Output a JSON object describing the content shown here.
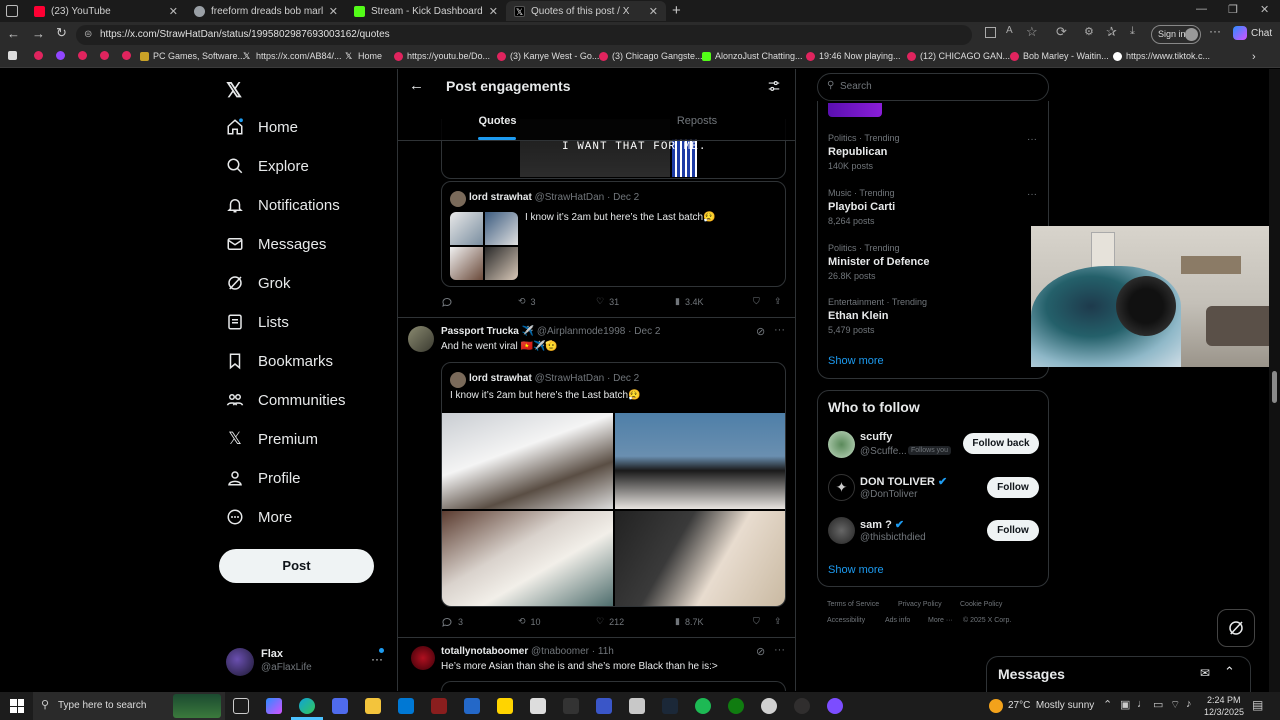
{
  "browser": {
    "tabs": [
      {
        "title": "(23) YouTube",
        "color": "#ff0033"
      },
      {
        "title": "freeform dreads bob marley - Go",
        "color": "#9aa0a6"
      },
      {
        "title": "Stream - Kick Dashboard",
        "color": "#53fc18"
      },
      {
        "title": "Quotes of this post / X",
        "color": "#ffffff"
      }
    ],
    "url": "https://x.com/StrawHatDan/status/1995802987693003162/quotes",
    "sign_in": "Sign in",
    "chat": "Chat",
    "bookmarks": [
      "PC Games, Software...",
      "https://x.com/AB84/...",
      "Home",
      "https://youtu.be/Do...",
      "(3) Kanye West - Go...",
      "(3) Chicago Gangste...",
      "AlonzoJust Chatting...",
      "19:46 Now playing...",
      "(12) CHICAGO GAN...",
      "Bob Marley - Waitin...",
      "https://www.tiktok.c..."
    ]
  },
  "nav": {
    "items": [
      "Home",
      "Explore",
      "Notifications",
      "Messages",
      "Grok",
      "Lists",
      "Bookmarks",
      "Communities",
      "Premium",
      "Profile",
      "More"
    ],
    "post_button": "Post",
    "account": {
      "name": "Flax",
      "handle": "@aFlaxLife"
    }
  },
  "header": {
    "title": "Post engagements",
    "tabs": [
      "Quotes",
      "Reposts"
    ],
    "banner_text": "I WANT THAT FOR ME."
  },
  "posts": [
    {
      "quote": {
        "name": "lord strawhat",
        "handle": "@StrawHatDan",
        "date": "Dec 2",
        "text": "I know it’s 2am but here’s the Last batch😮‍💨"
      },
      "stats": {
        "replies": "",
        "reposts": "3",
        "likes": "31",
        "views": "3.4K"
      }
    },
    {
      "name": "Passport Trucka ✈️",
      "handle": "@Airplanmode1998",
      "date": "Dec 2",
      "text": "And he went viral 🇻🇳✈️🫡",
      "quote": {
        "name": "lord strawhat",
        "handle": "@StrawHatDan",
        "date": "Dec 2",
        "text": "I know it’s 2am but here’s the Last batch😮‍💨"
      },
      "stats": {
        "replies": "3",
        "reposts": "10",
        "likes": "212",
        "views": "8.7K"
      }
    },
    {
      "name": "totallynotaboomer",
      "handle": "@tnaboomer",
      "date": "11h",
      "text": "He’s more Asian than she is and she’s more Black than he is:>"
    }
  ],
  "search": {
    "placeholder": "Search"
  },
  "trends": [
    {
      "category": "Politics · Trending",
      "name": "Republican",
      "count": "140K posts"
    },
    {
      "category": "Music · Trending",
      "name": "Playboi Carti",
      "count": "8,264 posts"
    },
    {
      "category": "Politics · Trending",
      "name": "Minister of Defence",
      "count": "26.8K posts"
    },
    {
      "category": "Entertainment · Trending",
      "name": "Ethan Klein",
      "count": "5,479 posts"
    }
  ],
  "trends_show_more": "Show more",
  "who_to_follow": {
    "title": "Who to follow",
    "accounts": [
      {
        "name": "scuffy",
        "handle": "@Scuffe...",
        "badge": "Follows you",
        "button": "Follow back"
      },
      {
        "name": "DON TOLIVER",
        "handle": "@DonToliver",
        "button": "Follow"
      },
      {
        "name": "sam ?",
        "handle": "@thisbicthdied",
        "button": "Follow"
      }
    ],
    "show_more": "Show more"
  },
  "footer": {
    "links": [
      "Terms of Service",
      "Privacy Policy",
      "Cookie Policy",
      "Accessibility",
      "Ads info",
      "More ···"
    ],
    "copyright": "© 2025 X Corp."
  },
  "messages_drawer": {
    "title": "Messages"
  },
  "taskbar": {
    "search_placeholder": "Type here to search",
    "weather": "27°C  Mostly sunny",
    "time": "2:24 PM",
    "date": "12/3/2025"
  },
  "colors": {
    "accent": "#1d9bf0",
    "background": "#000000",
    "border": "#2f3336"
  }
}
